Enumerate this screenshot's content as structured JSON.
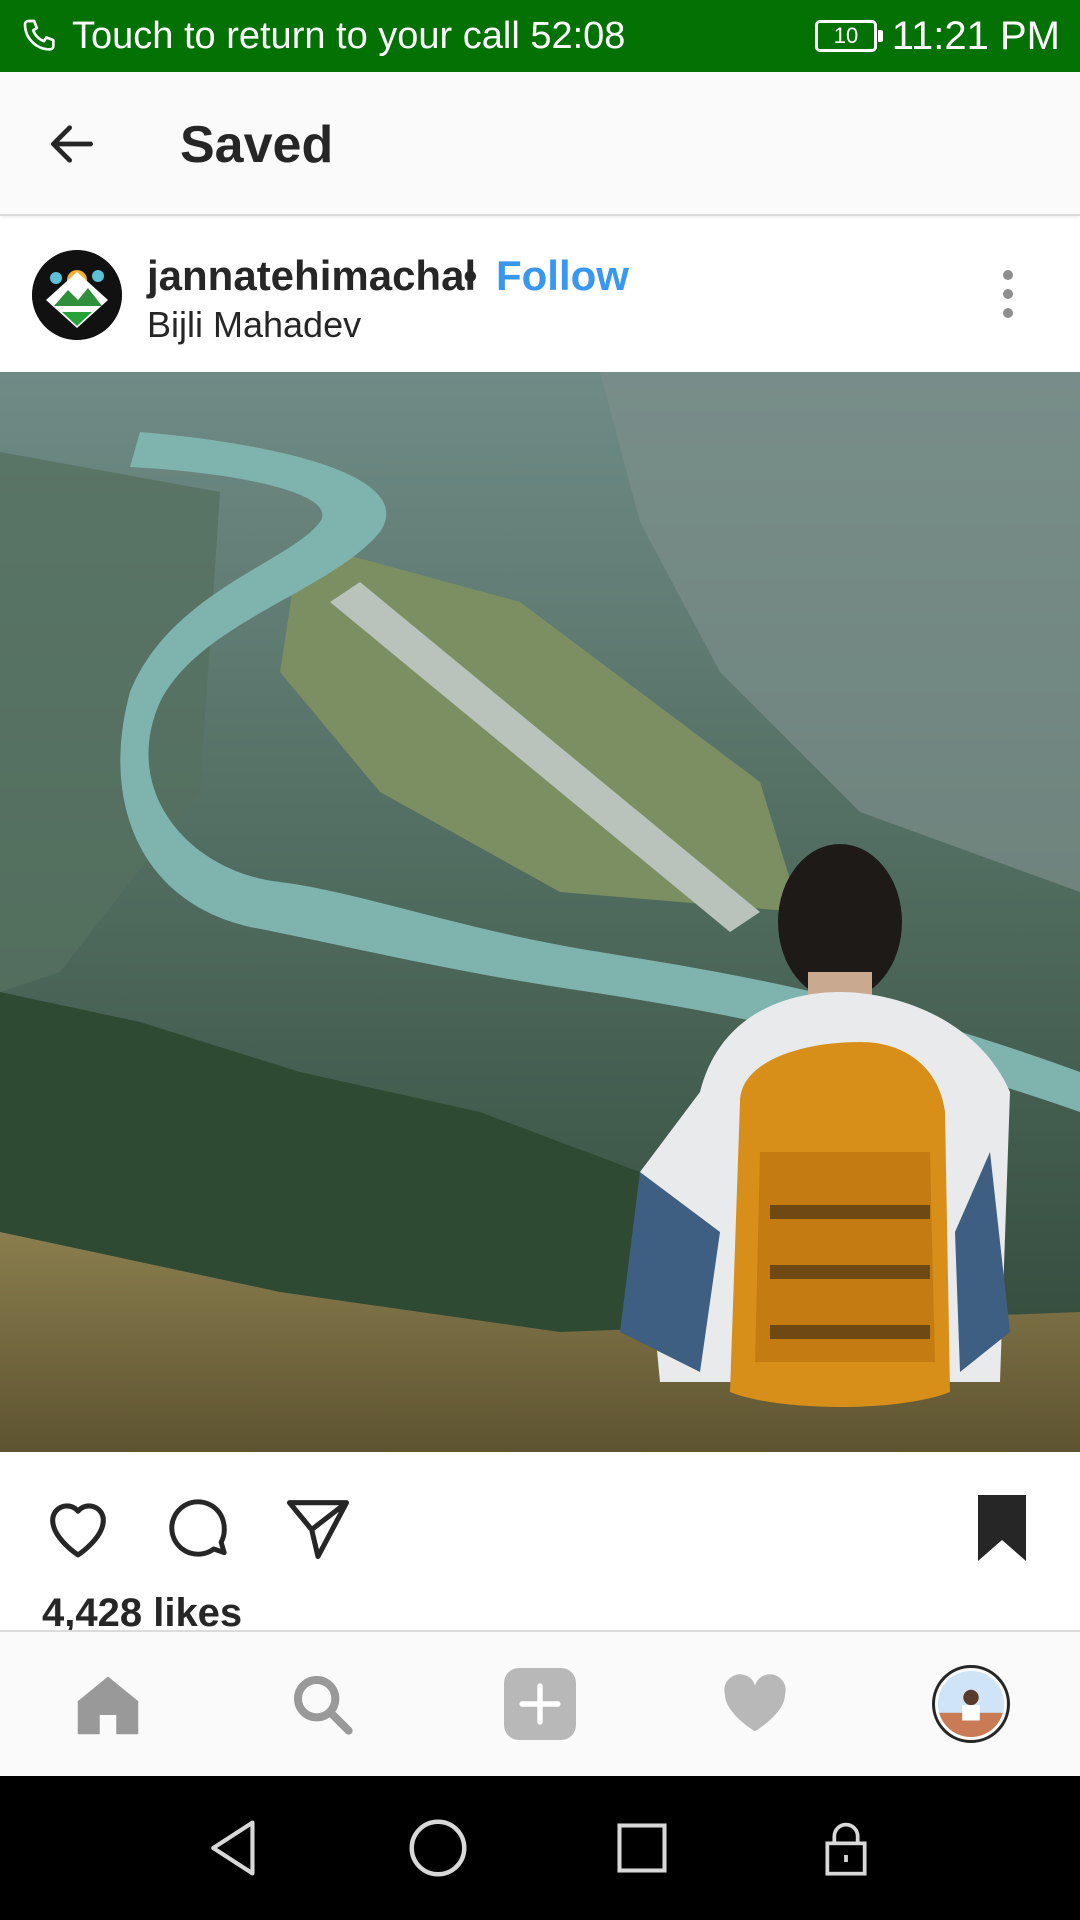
{
  "status_bar": {
    "call_text": "Touch to return to your call 52:08",
    "battery_level": "10",
    "clock": "11:21 PM",
    "background_color": "#037103"
  },
  "header": {
    "title": "Saved",
    "back_icon": "arrow-left-icon"
  },
  "post": {
    "username": "jannatehimachal",
    "separator": "•",
    "follow_label": "Follow",
    "location": "Bijli Mahadev",
    "avatar_label": "jannat-e-himachal",
    "likes": "4,428 likes",
    "saved": true,
    "accent_color": "#3897f0",
    "actions": [
      "heart-icon",
      "comment-icon",
      "send-icon",
      "bookmark-icon"
    ]
  },
  "bottom_nav": {
    "items": [
      "home-icon",
      "search-icon",
      "add-icon",
      "heart-icon",
      "profile-avatar"
    ],
    "active": "home"
  },
  "system_nav": {
    "items": [
      "back-icon",
      "home-icon",
      "recents-icon",
      "lock-icon"
    ]
  }
}
